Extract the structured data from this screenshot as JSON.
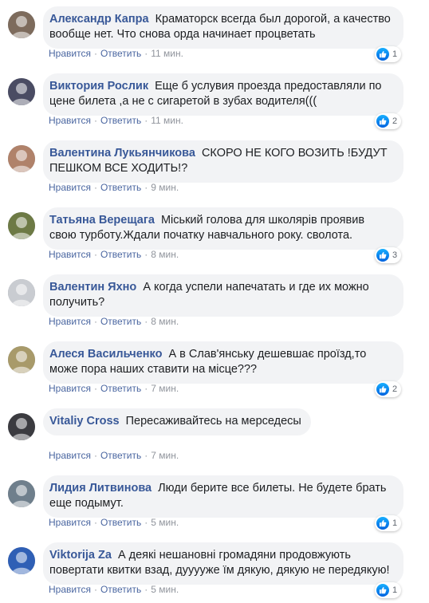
{
  "comments": [
    {
      "author": "Александр Капра",
      "text": "Краматорск всегда был дорогой, а качество вообще нет. Что снова орда начинает процветать",
      "like": "Нравится",
      "reply": "Ответить",
      "time": "11 мин.",
      "reactions": "1",
      "avatar_color": "#7d6b5c"
    },
    {
      "author": "Виктория Рослик",
      "text": "Еще б услувия проезда предоставляли по цене билета ,а не с сигаретой в зубах водителя(((",
      "like": "Нравится",
      "reply": "Ответить",
      "time": "11 мин.",
      "reactions": "2",
      "avatar_color": "#4a4c63"
    },
    {
      "author": "Валентина Лукьянчикова",
      "text": "СКОРО НЕ КОГО ВОЗИТЬ !БУДУТ ПЕШКОМ ВСЕ ХОДИТЬ!?",
      "like": "Нравится",
      "reply": "Ответить",
      "time": "9 мин.",
      "reactions": "",
      "avatar_color": "#b0826a"
    },
    {
      "author": "Татьяна Верещага",
      "text": "Міський голова для школярів проявив свою турботу.Ждали початку навчального року. сволота.",
      "like": "Нравится",
      "reply": "Ответить",
      "time": "8 мин.",
      "reactions": "3",
      "avatar_color": "#6d7a45"
    },
    {
      "author": "Валентин Яхно",
      "text": "А когда успели напечатать и где их можно получить?",
      "like": "Нравится",
      "reply": "Ответить",
      "time": "8 мин.",
      "reactions": "",
      "avatar_color": "#c9ccd1"
    },
    {
      "author": "Алеся Васильченко",
      "text": "А в Слав'янську дешевшає проїзд,то може пора наших ставити на місце???",
      "like": "Нравится",
      "reply": "Ответить",
      "time": "7 мин.",
      "reactions": "2",
      "avatar_color": "#a89a6a"
    },
    {
      "author": "Vitaliy Cross",
      "text": "Пересаживайтесь на мерседесы",
      "like": "Нравится",
      "reply": "Ответить",
      "time": "7 мин.",
      "reactions": "",
      "avatar_color": "#3b3b40"
    },
    {
      "author": "Лидия Литвинова",
      "text": "Люди берите все билеты. Не будете брать еще подымут.",
      "like": "Нравится",
      "reply": "Ответить",
      "time": "5 мин.",
      "reactions": "1",
      "avatar_color": "#6f7f8c"
    },
    {
      "author": "Viktorija Za",
      "text": "А деякі нешановні громадяни продовжують повертати квитки взад, дууууже їм дякую, дякую не передякую!",
      "like": "Нравится",
      "reply": "Ответить",
      "time": "5 мин.",
      "reactions": "1",
      "avatar_color": "#2f5fb5"
    }
  ]
}
